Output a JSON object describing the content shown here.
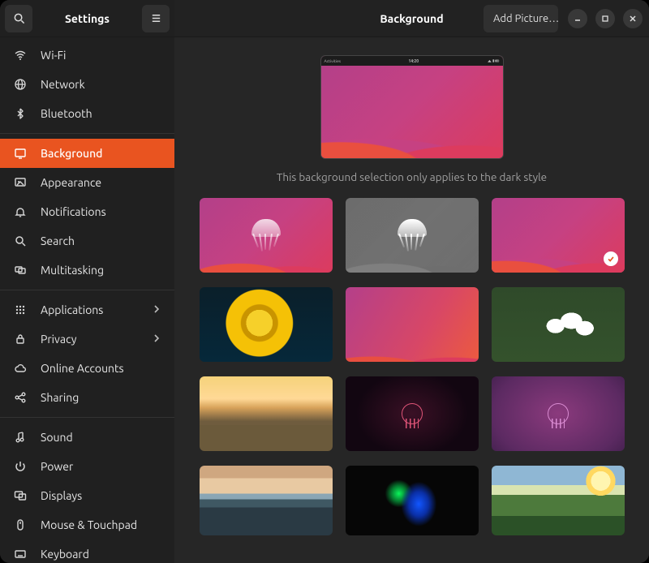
{
  "window": {
    "title": "Settings",
    "panel": "Background",
    "add_picture": "Add Picture…"
  },
  "sidebar": {
    "items": [
      {
        "id": "wifi",
        "label": "Wi-Fi",
        "icon": "wifi-icon"
      },
      {
        "id": "network",
        "label": "Network",
        "icon": "globe-icon"
      },
      {
        "id": "bluetooth",
        "label": "Bluetooth",
        "icon": "bluetooth-icon"
      },
      {
        "id": "background",
        "label": "Background",
        "icon": "background-icon",
        "selected": true
      },
      {
        "id": "appearance",
        "label": "Appearance",
        "icon": "appearance-icon"
      },
      {
        "id": "notifications",
        "label": "Notifications",
        "icon": "bell-icon"
      },
      {
        "id": "search",
        "label": "Search",
        "icon": "search-icon"
      },
      {
        "id": "multitasking",
        "label": "Multitasking",
        "icon": "multitasking-icon"
      },
      {
        "id": "applications",
        "label": "Applications",
        "icon": "grid-icon",
        "has_sub": true
      },
      {
        "id": "privacy",
        "label": "Privacy",
        "icon": "lock-icon",
        "has_sub": true
      },
      {
        "id": "online",
        "label": "Online Accounts",
        "icon": "cloud-icon"
      },
      {
        "id": "sharing",
        "label": "Sharing",
        "icon": "share-icon"
      },
      {
        "id": "sound",
        "label": "Sound",
        "icon": "sound-icon"
      },
      {
        "id": "power",
        "label": "Power",
        "icon": "power-icon"
      },
      {
        "id": "displays",
        "label": "Displays",
        "icon": "displays-icon"
      },
      {
        "id": "mouse",
        "label": "Mouse & Touchpad",
        "icon": "mouse-icon"
      },
      {
        "id": "keyboard",
        "label": "Keyboard",
        "icon": "keyboard-icon"
      }
    ],
    "separator_after": [
      "bluetooth",
      "multitasking",
      "sharing"
    ]
  },
  "background": {
    "hint": "This background selection only applies to the dark style",
    "preview_topbar": {
      "left": "Activities",
      "time": "14:20"
    },
    "selected_index": 2,
    "wallpapers": [
      {
        "name": "jammy-jellyfish-color",
        "style": "bg-waves-jelly",
        "jelly": true
      },
      {
        "name": "jammy-jellyfish-mono",
        "style": "bg-waves-jelly mono",
        "jelly": true
      },
      {
        "name": "ubuntu-waves-dark",
        "style": "bg-waves",
        "selected": true
      },
      {
        "name": "sunflower",
        "style": "bg-flower"
      },
      {
        "name": "ubuntu-waves",
        "style": "bg-waves2"
      },
      {
        "name": "spring-blossom",
        "style": "bg-blossom"
      },
      {
        "name": "country-road-sunset",
        "style": "bg-road"
      },
      {
        "name": "jellyfish-dark",
        "style": "bg-dark-jelly",
        "mini": "red"
      },
      {
        "name": "jellyfish-purple",
        "style": "bg-purple-jelly",
        "mini": "purple"
      },
      {
        "name": "mirror-lake",
        "style": "bg-lake"
      },
      {
        "name": "neon-lights",
        "style": "bg-neon"
      },
      {
        "name": "green-valley-sunset",
        "style": "bg-valley"
      }
    ]
  },
  "colors": {
    "accent": "#e95420"
  }
}
